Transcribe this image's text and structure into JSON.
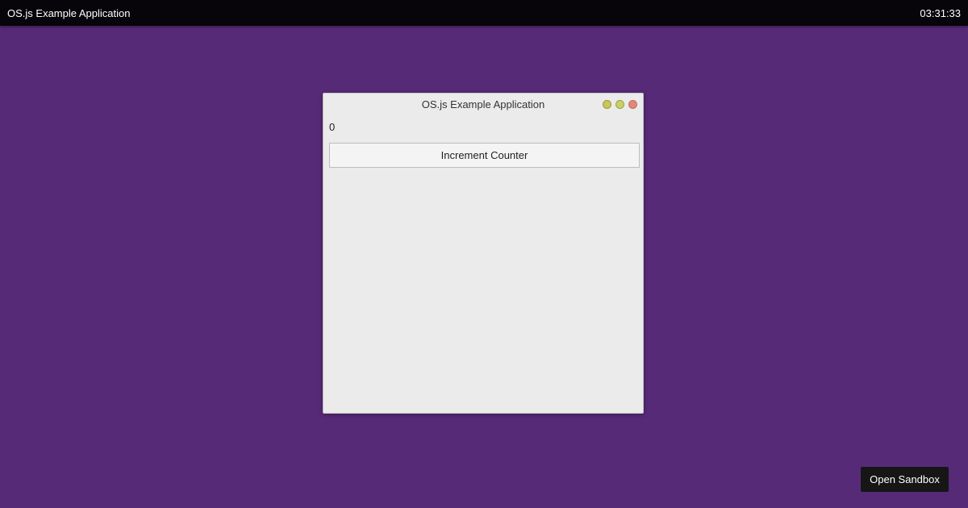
{
  "topbar": {
    "title": "OS.js Example Application",
    "clock": "03:31:33"
  },
  "window": {
    "title": "OS.js Example Application",
    "controls": [
      "minimize",
      "maximize",
      "close"
    ],
    "counter_value": "0",
    "increment_label": "Increment Counter"
  },
  "sandbox": {
    "label": "Open Sandbox"
  },
  "colors": {
    "desktop_background": "#572a78",
    "topbar_background": "#07050a",
    "window_background": "#ebebeb",
    "minimize_button": "#c9c65a",
    "maximize_button": "#c9d06a",
    "close_button": "#e1887b",
    "sandbox_button": "#161616"
  }
}
